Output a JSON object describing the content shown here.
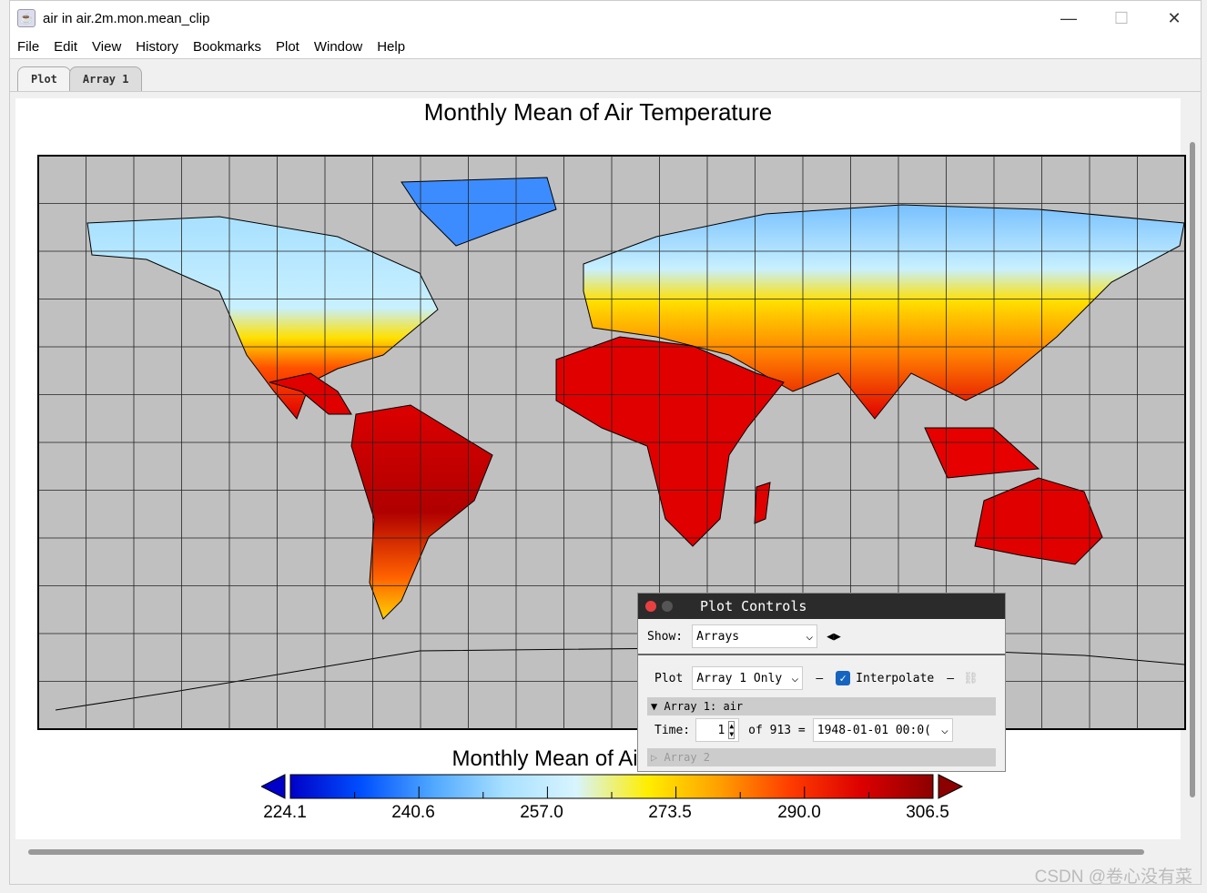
{
  "window": {
    "title": "air in air.2m.mon.mean_clip",
    "minimize": "—",
    "maximize": "☐",
    "close": "✕"
  },
  "menu": [
    "File",
    "Edit",
    "View",
    "History",
    "Bookmarks",
    "Plot",
    "Window",
    "Help"
  ],
  "tabs": [
    {
      "label": "Plot",
      "active": true
    },
    {
      "label": "Array 1",
      "active": false
    }
  ],
  "plot": {
    "title": "Monthly Mean of Air Temperature",
    "colorbar_title": "Monthly Mean of Air Temperature",
    "colorbar_ticks": [
      "224.1",
      "240.6",
      "257.0",
      "273.5",
      "290.0",
      "306.5"
    ],
    "colorbar_colors": [
      "#0000c8",
      "#0050ff",
      "#50a8ff",
      "#a8e0ff",
      "#d8f4ff",
      "#ffee00",
      "#ffa000",
      "#ff3c00",
      "#dc0000",
      "#8c0000"
    ],
    "background_color": "#c0c0c0"
  },
  "plot_controls": {
    "title": "Plot Controls",
    "show_label": "Show:",
    "show_value": "Arrays",
    "plot_label": "Plot",
    "plot_value": "Array 1 Only",
    "interpolate_label": "Interpolate",
    "interpolate_checked": true,
    "array1_header": "Array 1: air",
    "time_label": "Time:",
    "time_value": "1",
    "of_label": "of 913 =",
    "time_date": "1948-01-01 00:0(",
    "array2_header": "Array 2"
  },
  "watermark": "CSDN @卷心没有菜"
}
